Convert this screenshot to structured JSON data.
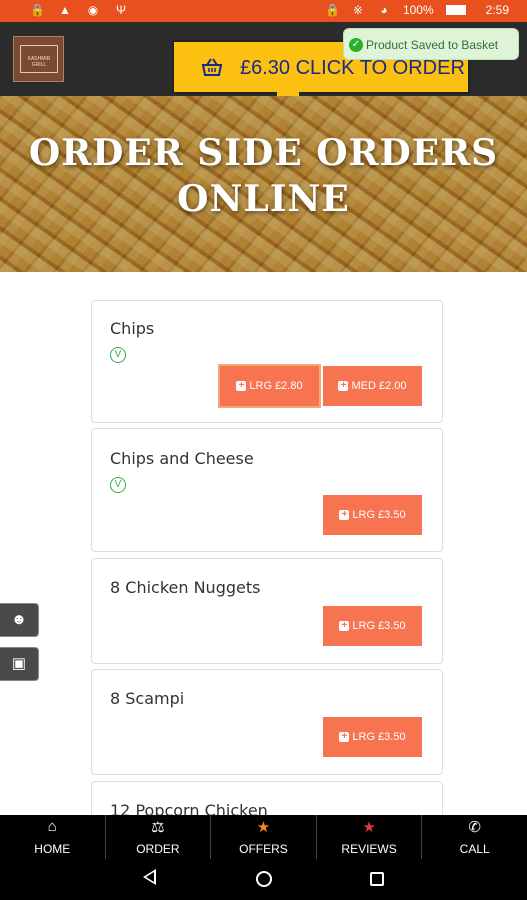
{
  "status_bar": {
    "battery": "100%",
    "time": "2:59",
    "left_icons": [
      "lock-icon",
      "warning-icon",
      "shield-icon",
      "usb-icon"
    ],
    "right_icons": [
      "lock-icon",
      "bluetooth-icon",
      "wifi-icon",
      "battery-icon"
    ]
  },
  "header": {
    "logo_text": "KASHMIR GRILL",
    "order_button_label": "£6.30 CLICK TO ORDER",
    "toast_text": "Product Saved to Basket"
  },
  "hero": {
    "title_line1": "ORDER SIDE ORDERS",
    "title_line2": "ONLINE"
  },
  "menu_items": [
    {
      "name": "Chips",
      "vegetarian": true,
      "options": [
        {
          "label": "LRG £2.80",
          "selected": true
        },
        {
          "label": "MED £2.00",
          "selected": false
        }
      ]
    },
    {
      "name": "Chips and Cheese",
      "vegetarian": true,
      "options": [
        {
          "label": "LRG £3.50"
        }
      ]
    },
    {
      "name": "8 Chicken Nuggets",
      "vegetarian": false,
      "options": [
        {
          "label": "LRG £3.50"
        }
      ]
    },
    {
      "name": "8 Scampi",
      "vegetarian": false,
      "options": [
        {
          "label": "LRG £3.50"
        }
      ]
    },
    {
      "name": "12 Popcorn Chicken",
      "vegetarian": false,
      "options": []
    }
  ],
  "side_buttons": [
    "user-icon",
    "contact-card-icon"
  ],
  "bottom_nav": [
    {
      "label": "HOME",
      "icon": "home-icon"
    },
    {
      "label": "ORDER",
      "icon": "cutlery-icon"
    },
    {
      "label": "OFFERS",
      "icon": "star-icon"
    },
    {
      "label": "REVIEWS",
      "icon": "star-icon"
    },
    {
      "label": "CALL",
      "icon": "phone-icon"
    }
  ],
  "colors": {
    "status_bar": "#e8501e",
    "header_bg": "#2b2b2b",
    "order_button": "#fcc010",
    "price_button": "#f87450",
    "offers_star": "#f08a1a",
    "reviews_star": "#e23b3b"
  }
}
